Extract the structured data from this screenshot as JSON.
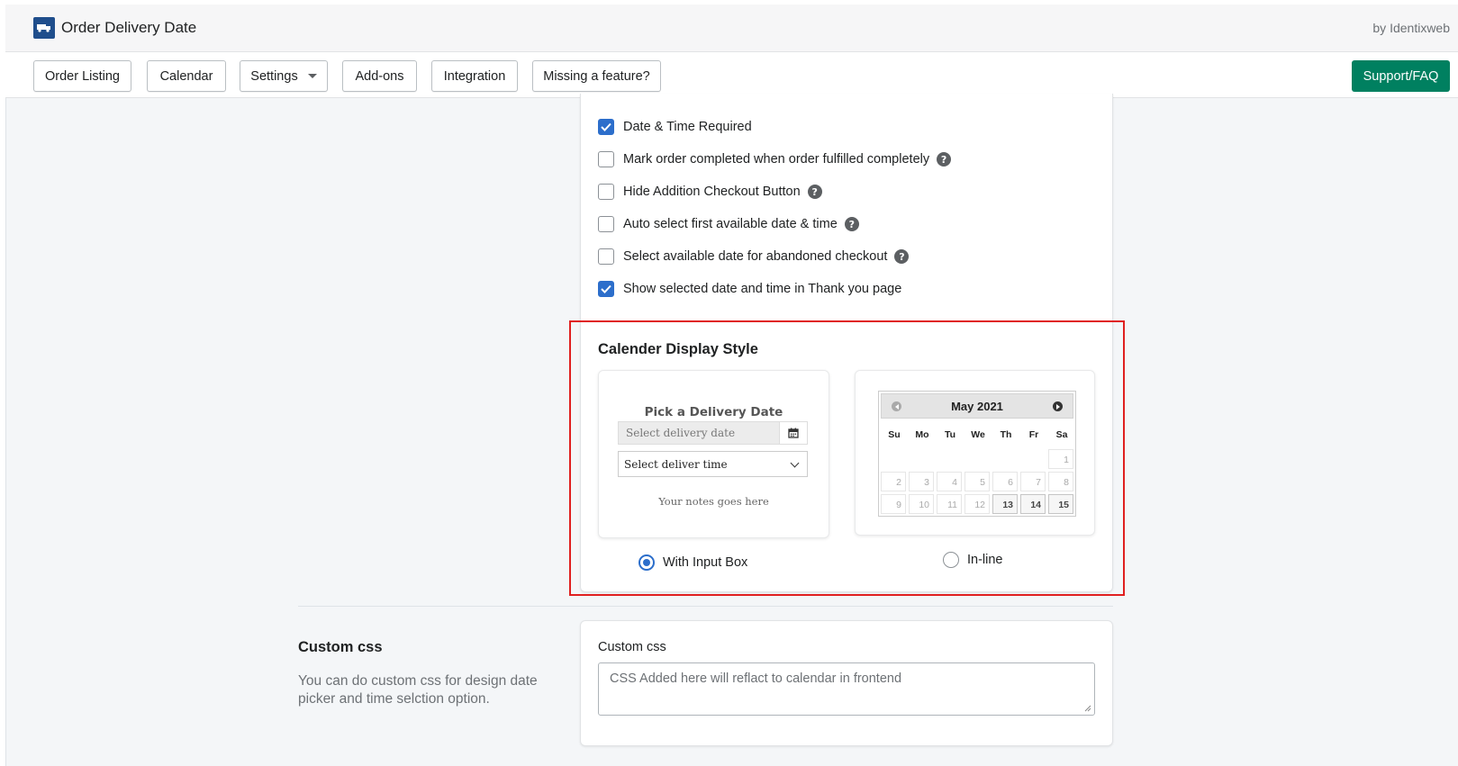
{
  "app": {
    "title": "Order Delivery Date",
    "by_line": "by Identixweb",
    "logo_icon": "truck-icon",
    "logo_color": "#1f4e8c"
  },
  "nav": {
    "items": [
      {
        "label": "Order Listing"
      },
      {
        "label": "Calendar"
      },
      {
        "label": "Settings",
        "dropdown": true
      },
      {
        "label": "Add-ons"
      },
      {
        "label": "Integration"
      },
      {
        "label": "Missing a feature?"
      }
    ],
    "support_label": "Support/FAQ",
    "support_color": "#008060"
  },
  "options": [
    {
      "label": "Date & Time Required",
      "checked": true,
      "help": false
    },
    {
      "label": "Mark order completed when order fulfilled completely",
      "checked": false,
      "help": true
    },
    {
      "label": "Hide Addition Checkout Button",
      "checked": false,
      "help": true
    },
    {
      "label": "Auto select first available date & time",
      "checked": false,
      "help": true
    },
    {
      "label": "Select available date for abandoned checkout",
      "checked": false,
      "help": true
    },
    {
      "label": "Show selected date and time in Thank you page",
      "checked": true,
      "help": false
    }
  ],
  "help_symbol": "?",
  "calendar_style": {
    "title": "Calender Display Style",
    "input_preview": {
      "heading": "Pick a Delivery Date",
      "date_placeholder": "Select delivery date",
      "time_placeholder": "Select deliver time",
      "notes": "Your notes goes here"
    },
    "inline_preview": {
      "month": "May 2021",
      "weekdays": [
        "Su",
        "Mo",
        "Tu",
        "We",
        "Th",
        "Fr",
        "Sa"
      ],
      "weeks": [
        [
          null,
          null,
          null,
          null,
          null,
          null,
          "1"
        ],
        [
          "2",
          "3",
          "4",
          "5",
          "6",
          "7",
          "8"
        ],
        [
          "9",
          "10",
          "11",
          "12",
          "13",
          "14",
          "15"
        ]
      ],
      "available_days": [
        "13",
        "14",
        "15"
      ]
    },
    "options": [
      {
        "label": "With Input Box",
        "selected": true
      },
      {
        "label": "In-line",
        "selected": false
      }
    ],
    "highlight_color": "#e02020"
  },
  "custom_css": {
    "section_title": "Custom css",
    "description": "You can do custom css for design date picker and time selction option.",
    "field_label": "Custom css",
    "placeholder": "CSS Added here will reflact to calendar in frontend"
  }
}
